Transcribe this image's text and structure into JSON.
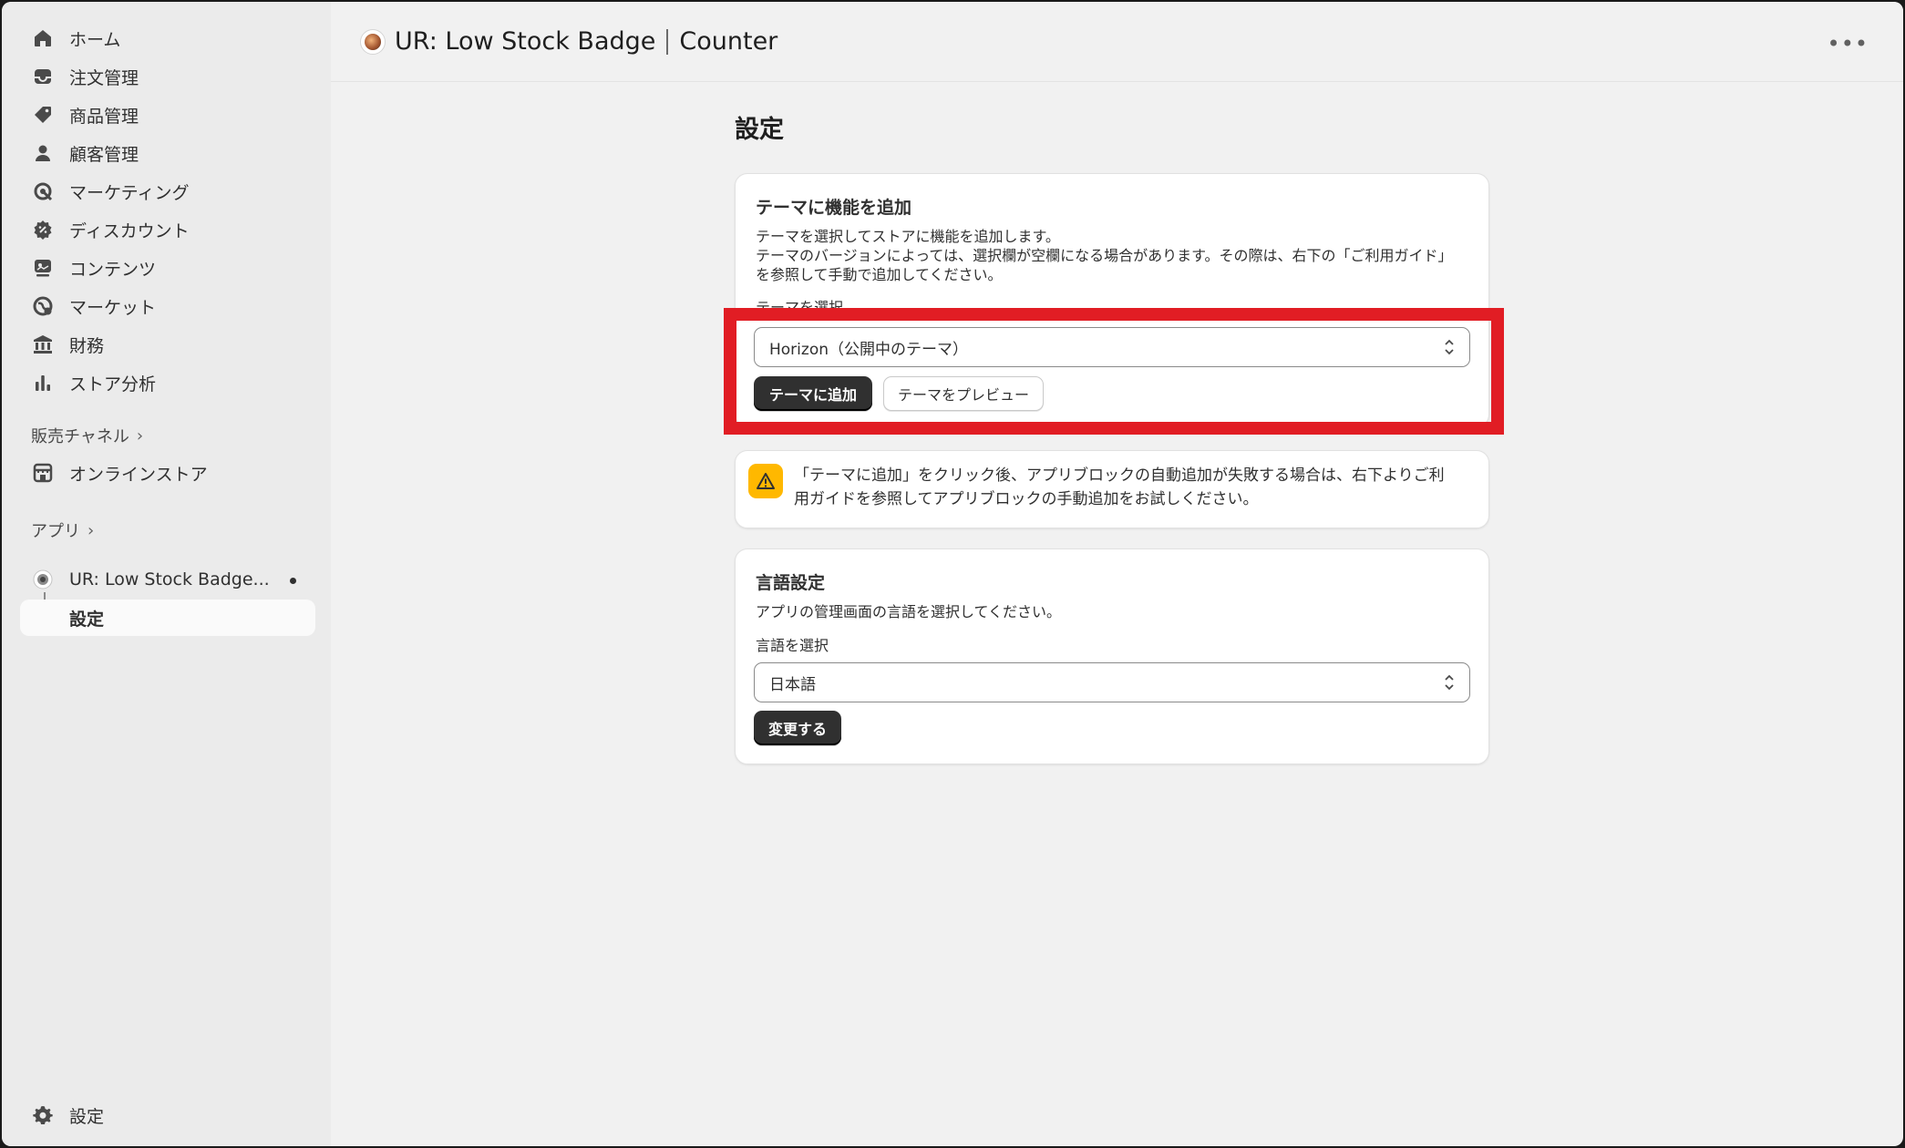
{
  "sidebar": {
    "items": [
      {
        "label": "ホーム",
        "icon": "home-icon"
      },
      {
        "label": "注文管理",
        "icon": "inbox-icon"
      },
      {
        "label": "商品管理",
        "icon": "tag-icon"
      },
      {
        "label": "顧客管理",
        "icon": "person-icon"
      },
      {
        "label": "マーケティング",
        "icon": "target-icon"
      },
      {
        "label": "ディスカウント",
        "icon": "discount-icon"
      },
      {
        "label": "コンテンツ",
        "icon": "content-icon"
      },
      {
        "label": "マーケット",
        "icon": "globe-icon"
      },
      {
        "label": "財務",
        "icon": "bank-icon"
      },
      {
        "label": "ストア分析",
        "icon": "chart-icon"
      }
    ],
    "sales_channels_label": "販売チャネル",
    "online_store_label": "オンラインストア",
    "apps_label": "アプリ",
    "app_name": "UR: Low Stock Badge...",
    "app_sub_settings": "設定",
    "settings_label": "設定"
  },
  "header": {
    "app_title": "UR: Low Stock Badge",
    "app_subtitle": "Counter"
  },
  "main": {
    "page_title": "設定",
    "theme_card": {
      "title": "テーマに機能を追加",
      "desc_line1": "テーマを選択してストアに機能を追加します。",
      "desc_line2": "テーマのバージョンによっては、選択欄が空欄になる場合があります。その際は、右下の「ご利用ガイド」",
      "desc_line3": "を参照して手動で追加してください。",
      "select_label": "テーマを選択",
      "selected_theme": "Horizon（公開中のテーマ）",
      "add_button": "テーマに追加",
      "preview_button": "テーマをプレビュー"
    },
    "warning": {
      "line1": "「テーマに追加」をクリック後、アプリブロックの自動追加が失敗する場合は、右下よりご利",
      "line2": "用ガイドを参照してアプリブロックの手動追加をお試しください。"
    },
    "language_card": {
      "title": "言語設定",
      "desc": "アプリの管理画面の言語を選択してください。",
      "select_label": "言語を選択",
      "selected_language": "日本語",
      "change_button": "変更する"
    }
  },
  "colors": {
    "highlight": "#e11d24",
    "warning": "#ffb800",
    "primary_button": "#303030"
  }
}
